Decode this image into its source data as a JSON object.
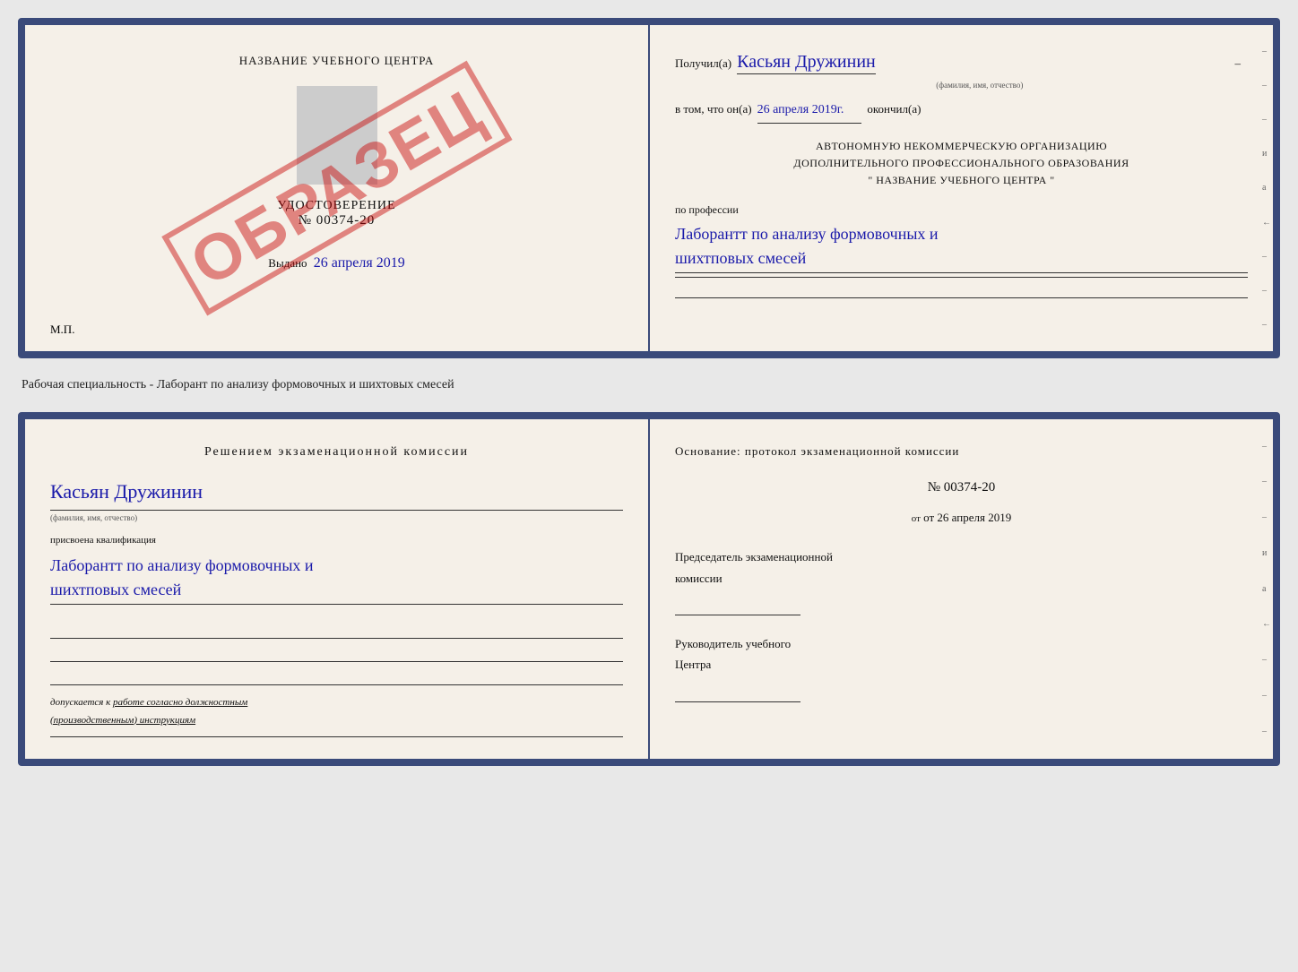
{
  "top_document": {
    "left": {
      "center_title": "НАЗВАНИЕ УЧЕБНОГО ЦЕНТРА",
      "cert_label": "УДОСТОВЕРЕНИЕ",
      "cert_number": "№ 00374-20",
      "vydano_text": "Выдано",
      "vydano_date": "26 апреля 2019",
      "mp_text": "М.П.",
      "obrazec_text": "ОБРАЗЕЦ"
    },
    "right": {
      "poluchil_label": "Получил(а)",
      "handwritten_name": "Касьян Дружинин",
      "fio_sublabel": "(фамилия, имя, отчество)",
      "vtom_label": "в том, что он(а)",
      "handwritten_date": "26 апреля 2019г.",
      "okonchil_label": "окончил(а)",
      "org_line1": "АВТОНОМНУЮ НЕКОММЕРЧЕСКУЮ ОРГАНИЗАЦИЮ",
      "org_line2": "ДОПОЛНИТЕЛЬНОГО ПРОФЕССИОНАЛЬНОГО ОБРАЗОВАНИЯ",
      "org_line3": "\"  НАЗВАНИЕ УЧЕБНОГО ЦЕНТРА  \"",
      "po_professii_label": "по профессии",
      "handwritten_profession": "Лаборантт по анализу формовочных и\nшихтповых смесей",
      "right_marks": [
        "–",
        "–",
        "–",
        "и",
        "а",
        "←",
        "–",
        "–",
        "–"
      ]
    }
  },
  "middle_label": "Рабочая специальность - Лаборант по анализу формовочных и шихтовых смесей",
  "bottom_document": {
    "left": {
      "resheniem_title": "Решением  экзаменационной  комиссии",
      "handwritten_name": "Касьян  Дружинин",
      "fio_sublabel": "(фамилия, имя, отчество)",
      "prisvoena_label": "присвоена квалификация",
      "handwritten_profession": "Лаборантт по анализу формовочных и\nшихтповых смесей",
      "dopuskaetsya_text": "допускается к",
      "dopuskaetsya_underline": "работе согласно должностным\n(производственным) инструкциям"
    },
    "right": {
      "osnovanie_title": "Основание: протокол экзаменационной  комиссии",
      "protocol_number": "№  00374-20",
      "ot_text": "от 26 апреля 2019",
      "predsedatel_title": "Председатель экзаменационной\nкомиссии",
      "rukovoditel_title": "Руководитель учебного\nЦентра",
      "right_marks": [
        "–",
        "–",
        "–",
        "и",
        "а",
        "←",
        "–",
        "–",
        "–"
      ]
    }
  }
}
